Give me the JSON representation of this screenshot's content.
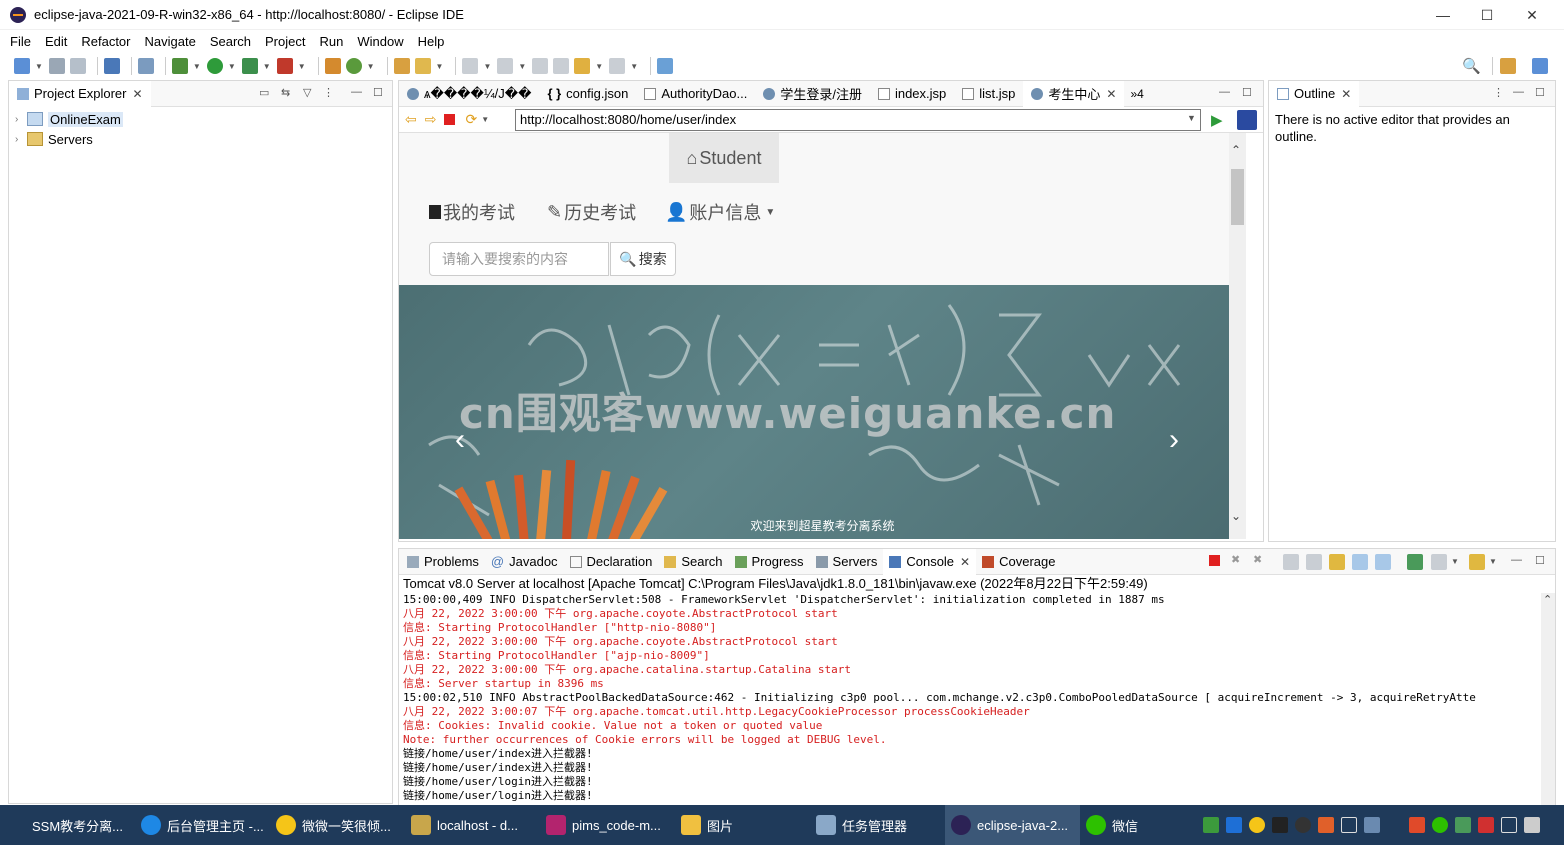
{
  "window": {
    "title": "eclipse-java-2021-09-R-win32-x86_64 - http://localhost:8080/ - Eclipse IDE",
    "minimize": "—",
    "maximize": "☐",
    "close": "✕"
  },
  "menu": [
    "File",
    "Edit",
    "Refactor",
    "Navigate",
    "Search",
    "Project",
    "Run",
    "Window",
    "Help"
  ],
  "project_explorer": {
    "tab_label": "Project Explorer",
    "items": [
      {
        "label": "OnlineExam",
        "icon": "project-icon"
      },
      {
        "label": "Servers",
        "icon": "folder-icon"
      }
    ]
  },
  "editor": {
    "tabs": [
      {
        "label": "ѧ����¼/J��",
        "icon": "globe-icon"
      },
      {
        "label": "config.json",
        "icon": "json-icon"
      },
      {
        "label": "AuthorityDao...",
        "icon": "file-icon"
      },
      {
        "label": "学生登录/注册",
        "icon": "globe-icon"
      },
      {
        "label": "index.jsp",
        "icon": "file-icon"
      },
      {
        "label": "list.jsp",
        "icon": "file-icon"
      },
      {
        "label": "考生中心",
        "icon": "globe-icon"
      }
    ],
    "overflow_count": "»4",
    "url": "http://localhost:8080/home/user/index"
  },
  "site": {
    "brand": "Student",
    "nav": [
      "我的考试",
      "历史考试",
      "账户信息"
    ],
    "search_placeholder": "请输入要搜索的内容",
    "search_button": "搜索",
    "watermark": "cn围观客www.weiguanke.cn",
    "carousel_caption": "欢迎来到超星教考分离系统"
  },
  "outline": {
    "tab_label": "Outline",
    "message": "There is no active editor that provides an outline."
  },
  "bottom": {
    "tabs": [
      "Problems",
      "Javadoc",
      "Declaration",
      "Search",
      "Progress",
      "Servers",
      "Console",
      "Coverage"
    ],
    "active_tab": "Console",
    "console_header": "Tomcat v8.0 Server at localhost [Apache Tomcat] C:\\Program Files\\Java\\jdk1.8.0_181\\bin\\javaw.exe  (2022年8月22日下午2:59:49)",
    "lines": [
      {
        "text": "15:00:00,409  INFO DispatcherServlet:508 - FrameworkServlet 'DispatcherServlet': initialization completed in 1887 ms",
        "type": "out"
      },
      {
        "text": "八月 22, 2022 3:00:00 下午 org.apache.coyote.AbstractProtocol start",
        "type": "err"
      },
      {
        "text": "信息: Starting ProtocolHandler [\"http-nio-8080\"]",
        "type": "err"
      },
      {
        "text": "八月 22, 2022 3:00:00 下午 org.apache.coyote.AbstractProtocol start",
        "type": "err"
      },
      {
        "text": "信息: Starting ProtocolHandler [\"ajp-nio-8009\"]",
        "type": "err"
      },
      {
        "text": "八月 22, 2022 3:00:00 下午 org.apache.catalina.startup.Catalina start",
        "type": "err"
      },
      {
        "text": "信息: Server startup in 8396 ms",
        "type": "err"
      },
      {
        "text": "15:00:02,510  INFO AbstractPoolBackedDataSource:462 - Initializing c3p0 pool... com.mchange.v2.c3p0.ComboPooledDataSource [ acquireIncrement -> 3, acquireRetryAtte",
        "type": "out"
      },
      {
        "text": "八月 22, 2022 3:00:07 下午 org.apache.tomcat.util.http.LegacyCookieProcessor processCookieHeader",
        "type": "err"
      },
      {
        "text": "信息: Cookies: Invalid cookie. Value not a token or quoted value",
        "type": "err"
      },
      {
        "text": " Note: further occurrences of Cookie errors will be logged at DEBUG level.",
        "type": "err"
      },
      {
        "text": "链接/home/user/index进入拦截器!",
        "type": "out"
      },
      {
        "text": "链接/home/user/index进入拦截器!",
        "type": "out"
      },
      {
        "text": "链接/home/user/login进入拦截器!",
        "type": "out"
      },
      {
        "text": "链接/home/user/login进入拦截器!",
        "type": "out"
      }
    ]
  },
  "taskbar": {
    "tasks": [
      {
        "label": "SSM教考分离...",
        "color": "#1f3a5a"
      },
      {
        "label": "后台管理主页 -...",
        "color": "#1e88e5"
      },
      {
        "label": "微微一笑很倾...",
        "color": "#f5c518"
      },
      {
        "label": "localhost - d...",
        "color": "#c8a64b"
      },
      {
        "label": "pims_code-m...",
        "color": "#b3246e"
      },
      {
        "label": "图片",
        "color": "#f0c040"
      },
      {
        "label": "任务管理器",
        "color": "#8aa8c8"
      },
      {
        "label": "eclipse-java-2...",
        "color": "#2c2255"
      },
      {
        "label": "微信",
        "color": "#2dc100"
      }
    ]
  },
  "colors": {
    "taskbar": "#1f3a5a",
    "console_error": "#d62020",
    "carousel": "#557a7e"
  }
}
